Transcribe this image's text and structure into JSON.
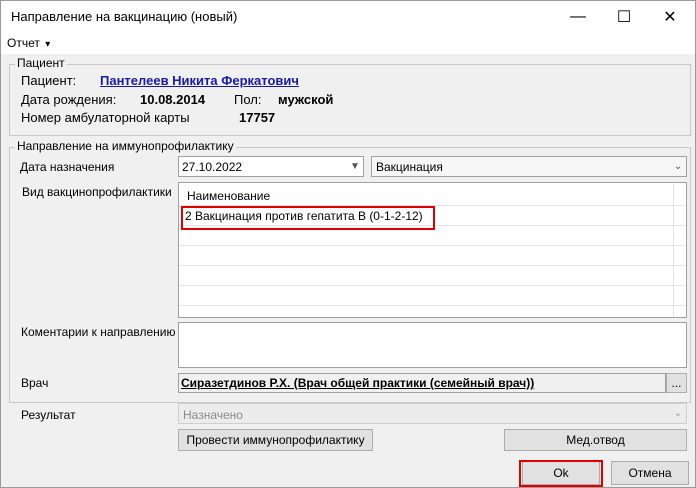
{
  "window": {
    "title": "Направление на вакцинацию  (новый)",
    "minimize_glyph": "—",
    "maximize_glyph": "☐",
    "close_glyph": "✕"
  },
  "menu": {
    "report_label": "Отчет",
    "report_arrow": "▾"
  },
  "patient": {
    "group_label": "Пациент",
    "patient_label": "Пациент:",
    "patient_name": "Пантелеев Никита Феркатович",
    "birth_label": "Дата рождения:",
    "birth_date": "10.08.2014",
    "sex_label": "Пол:",
    "sex_value": "мужской",
    "card_label": "Номер амбулаторной карты",
    "card_number": "17757"
  },
  "referral": {
    "group_label": "Направление на иммунопрофилактику",
    "date_label": "Дата назначения",
    "date_value": "27.10.2022",
    "type_value": "Вакцинация",
    "vaccine_kind_label": "Вид вакцинопрофилактики",
    "table_header": "Наименование",
    "table_rows": [
      "2 Вакцинация против гепатита В (0-1-2-12)"
    ],
    "comments_label": "Коментарии к направлению",
    "comments_value": "",
    "doctor_label": "Врач",
    "doctor_value": "Сиразетдинов Р.Х. (Врач общей практики (семейный врач))",
    "doctor_button": "..."
  },
  "result": {
    "label": "Результат",
    "value": "Назначено"
  },
  "buttons": {
    "perform": "Провести иммунопрофилактику",
    "med_exemption": "Мед.отвод",
    "ok": "Ok",
    "cancel": "Отмена"
  },
  "colors": {
    "highlight": "#e00000",
    "link": "#1a1aa8"
  }
}
